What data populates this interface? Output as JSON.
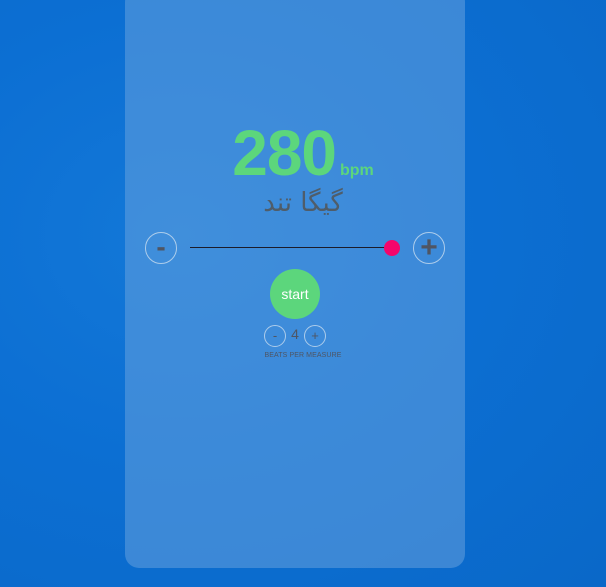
{
  "tempo": {
    "value": "280",
    "unit": "bpm",
    "name": "گیگا تند",
    "decrease_label": "-",
    "increase_label": "+",
    "slider_level_fraction": 1.0
  },
  "controls": {
    "start_label": "start"
  },
  "beats": {
    "decrease_label": "-",
    "value": "4",
    "increase_label": "+",
    "label": "BEATS PER MEASURE"
  },
  "colors": {
    "accent": "#5cd67c",
    "slider_thumb": "#f5056b",
    "background": "#0c6fd3"
  }
}
